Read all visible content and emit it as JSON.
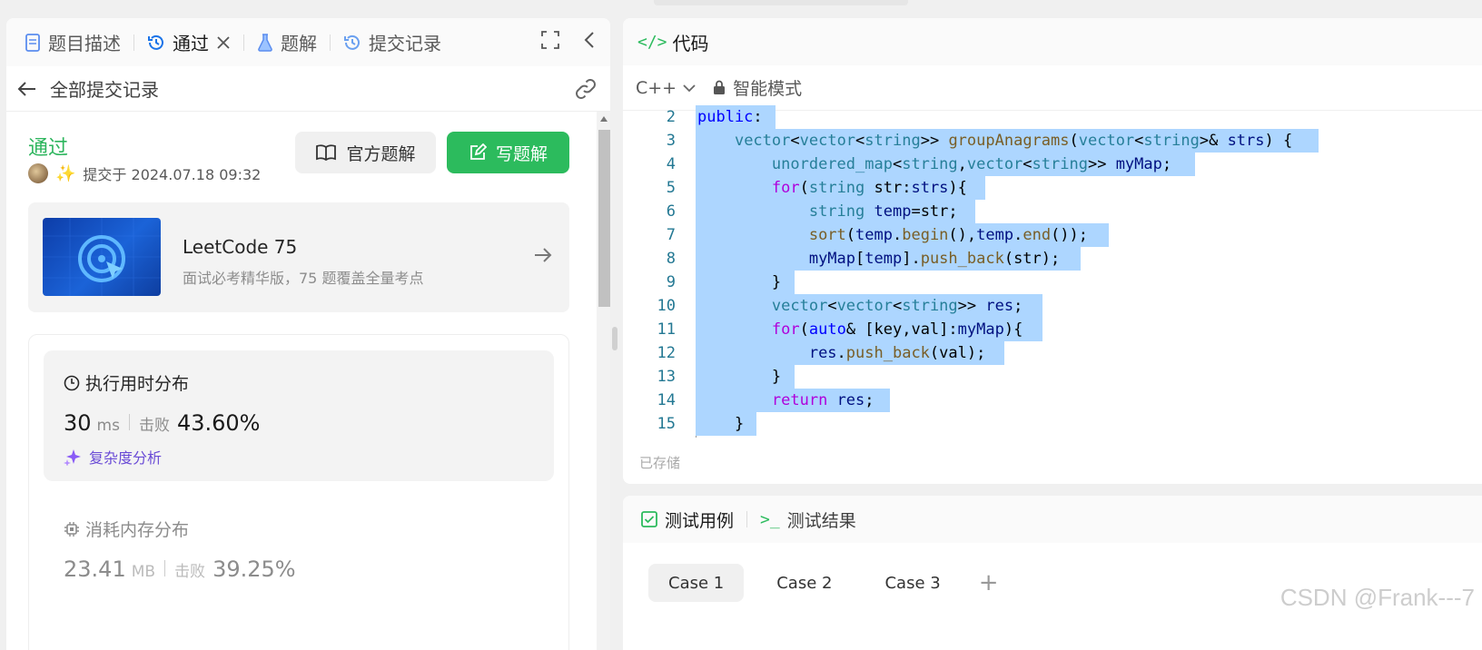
{
  "tabs": [
    {
      "label": "题目描述",
      "icon": "document-icon"
    },
    {
      "label": "通过",
      "icon": "history-icon",
      "active": true
    },
    {
      "label": "题解",
      "icon": "flask-icon"
    },
    {
      "label": "提交记录",
      "icon": "history-icon"
    }
  ],
  "back_label": "全部提交记录",
  "submission": {
    "status": "通过",
    "submitted_at": "提交于 2024.07.18 09:32",
    "official_solution_label": "官方题解",
    "write_solution_label": "写题解"
  },
  "promo": {
    "title": "LeetCode 75",
    "subtitle": "面试必考精华版，75 题覆盖全量考点"
  },
  "runtime": {
    "title": "执行用时分布",
    "value": "30",
    "unit": "ms",
    "beat_label": "击败",
    "beat": "43.60%",
    "complexity_label": "复杂度分析"
  },
  "memory": {
    "title": "消耗内存分布",
    "value": "23.41",
    "unit": "MB",
    "beat_label": "击败",
    "beat": "39.25%"
  },
  "code_panel": {
    "title": "代码",
    "language": "C++",
    "mode": "智能模式",
    "saved": "已存储"
  },
  "code_lines": [
    {
      "n": "2",
      "text": "public:"
    },
    {
      "n": "3",
      "text": "    vector<vector<string>> groupAnagrams(vector<string>& strs) {"
    },
    {
      "n": "4",
      "text": "        unordered_map<string,vector<string>> myMap;"
    },
    {
      "n": "5",
      "text": "        for(string str:strs){"
    },
    {
      "n": "6",
      "text": "            string temp=str;"
    },
    {
      "n": "7",
      "text": "            sort(temp.begin(),temp.end());"
    },
    {
      "n": "8",
      "text": "            myMap[temp].push_back(str);"
    },
    {
      "n": "9",
      "text": "        }"
    },
    {
      "n": "10",
      "text": "        vector<vector<string>> res;"
    },
    {
      "n": "11",
      "text": "        for(auto& [key,val]:myMap){"
    },
    {
      "n": "12",
      "text": "            res.push_back(val);"
    },
    {
      "n": "13",
      "text": "        }"
    },
    {
      "n": "14",
      "text": "        return res;"
    },
    {
      "n": "15",
      "text": "    }"
    }
  ],
  "test_panel": {
    "tab_cases": "测试用例",
    "tab_results": "测试结果",
    "cases": [
      "Case 1",
      "Case 2",
      "Case 3"
    ],
    "add": "+"
  },
  "watermark": "CSDN @Frank---7",
  "colors": {
    "accent_green": "#2cbb5d",
    "selection": "#add6ff"
  }
}
